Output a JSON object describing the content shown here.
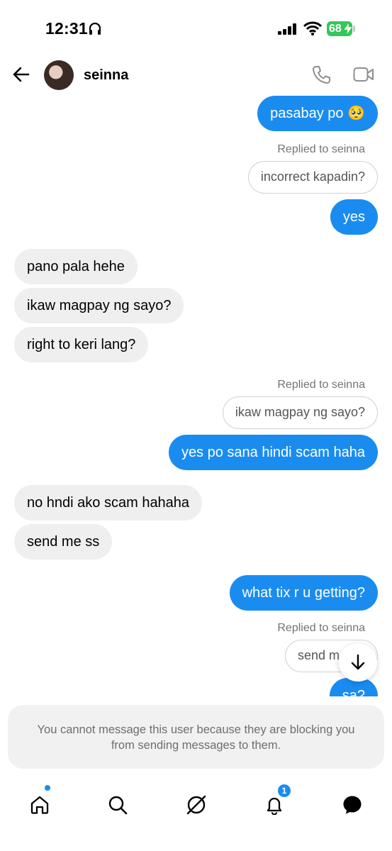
{
  "status_bar": {
    "time": "12:31",
    "battery": "68"
  },
  "header": {
    "username": "seinna"
  },
  "messages": {
    "m1": "pasabay po 🥺",
    "reply1_label": "Replied to seinna",
    "reply1_quote": "incorrect kapadin?",
    "m2": "yes",
    "m3": "pano pala hehe",
    "m4": "ikaw magpay ng sayo?",
    "m5": "right to keri lang?",
    "reply2_label": "Replied to seinna",
    "reply2_quote": "ikaw magpay ng sayo?",
    "m6": "yes po sana hindi scam haha",
    "m7": "no hndi ako scam hahaha",
    "m8": "send me ss",
    "m9": "what tix r u getting?",
    "reply3_label": "Replied to seinna",
    "reply3_quote": "send m",
    "m10": "sa?"
  },
  "blocked_notice": "You cannot message this user because they are blocking you from sending messages to them.",
  "tabbar": {
    "notification_count": "1"
  },
  "colors": {
    "outgoing": "#1a8cf0",
    "incoming": "#efefef",
    "battery": "#34c759"
  },
  "icons": [
    "back-arrow-icon",
    "phone-icon",
    "video-camera-icon",
    "home-icon",
    "search-icon",
    "explore-icon",
    "bell-icon",
    "messages-icon",
    "arrow-down-icon",
    "headphones-icon",
    "signal-icon",
    "wifi-icon",
    "battery-icon"
  ]
}
